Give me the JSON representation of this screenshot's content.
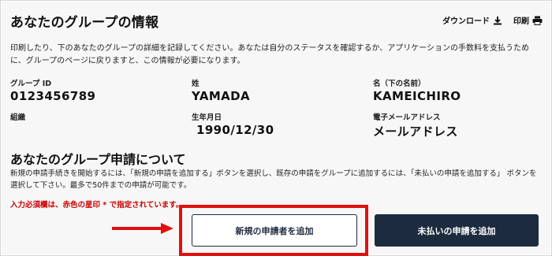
{
  "header": {
    "title": "あなたのグループの情報",
    "download_label": "ダウンロード",
    "print_label": "印刷"
  },
  "intro_text": "印刷したり、下のあなたのグループの詳細を記録してください。あなたは自分のステータスを確認するか、アプリケーションの手数料を支払うために、グループのページに戻りますと、この情報が必要になります。",
  "fields": {
    "group_id": {
      "label": "グループ ID",
      "value": "0123456789"
    },
    "last_name": {
      "label": "姓",
      "value": "YAMADA"
    },
    "first_name": {
      "label": "名（下の名前）",
      "value": "KAMEICHIRO"
    },
    "organization": {
      "label": "組織",
      "value": ""
    },
    "birthdate": {
      "label": "生年月日",
      "value": "1990/12/30"
    },
    "email": {
      "label": "電子メールアドレス",
      "value": "メールアドレス"
    }
  },
  "applications": {
    "title": "あなたのグループ申請について",
    "description": "新規の申請手続きを開始するには、「新規の申請を追加する」ボタンを選択し、既存の申請をグループに追加するには、「未払いの申請を追加する」 ボタンを選択して下さい。最多で50件までの申請が可能です。",
    "required_note": "入力必須欄は、赤色の星印 * で指定されています。",
    "add_new_button": "新規の申請者を追加",
    "add_unpaid_button": "未払いの申請を追加"
  },
  "colors": {
    "primary": "#1d2b3f",
    "highlight": "#e01010",
    "required": "#cc0000"
  },
  "icons": {
    "download": "download-icon",
    "print": "print-icon"
  }
}
